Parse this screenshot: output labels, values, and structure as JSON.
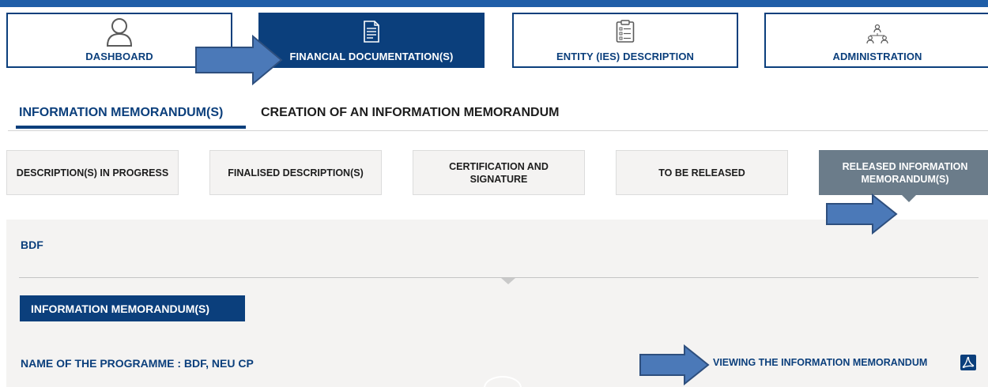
{
  "nav": {
    "tiles": [
      {
        "label": "DASHBOARD",
        "icon": "user-icon"
      },
      {
        "label": "FINANCIAL DOCUMENTATION(S)",
        "icon": "document-icon"
      },
      {
        "label": "ENTITY (IES) DESCRIPTION",
        "icon": "clipboard-icon"
      },
      {
        "label": "ADMINISTRATION",
        "icon": "org-chart-icon"
      }
    ],
    "active_index": 1
  },
  "subtabs": {
    "items": [
      "INFORMATION MEMORANDUM(S)",
      "CREATION OF AN INFORMATION MEMORANDUM"
    ],
    "active_index": 0
  },
  "status_tabs": {
    "items": [
      "DESCRIPTION(S) IN PROGRESS",
      "FINALISED DESCRIPTION(S)",
      "CERTIFICATION AND SIGNATURE",
      "TO BE RELEASED",
      "RELEASED INFORMATION MEMORANDUM(S)"
    ],
    "active_index": 4
  },
  "panel": {
    "entity": "BDF",
    "section_title": "INFORMATION MEMORANDUM(S)",
    "programme": "NAME OF THE PROGRAMME : BDF, NEU CP",
    "view_link": "VIEWING THE INFORMATION MEMORANDUM",
    "view_icon": "pdf-icon"
  },
  "colors": {
    "brand_navy": "#0b3f7c",
    "top_bar": "#1f5ea8",
    "active_status": "#6b7c8a",
    "panel_bg": "#f4f3f2",
    "annotation_arrow": "#4b79b8"
  }
}
